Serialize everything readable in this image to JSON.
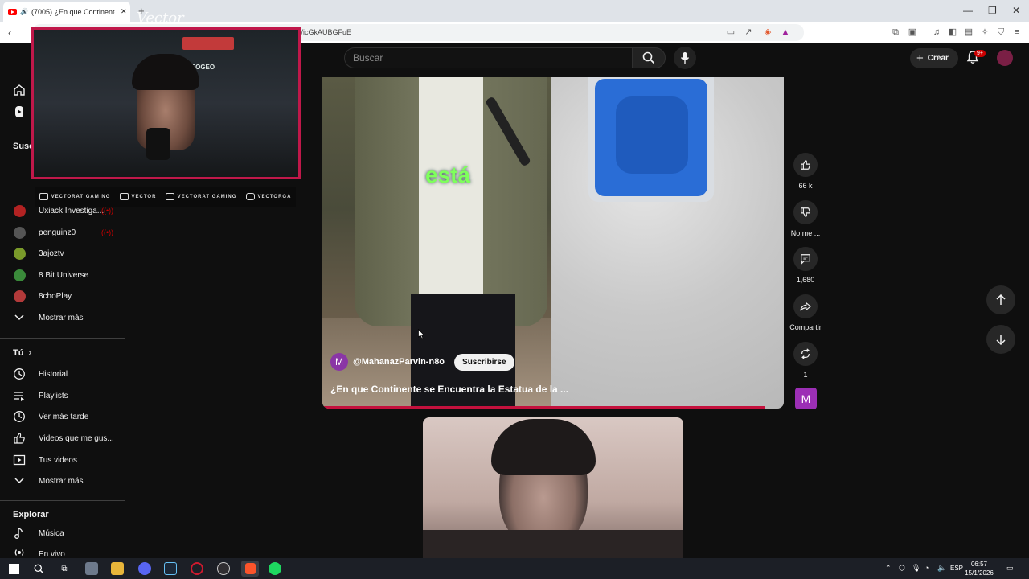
{
  "browser": {
    "tab_title": "(7005) ¿En que Continente se",
    "new_tab": "+",
    "url": "s/icGkAUBGFuE",
    "window_controls": [
      "—",
      "❐",
      "✕"
    ]
  },
  "youtube": {
    "search_placeholder": "Buscar",
    "create_label": "Crear",
    "notification_badge": "9+"
  },
  "sidebar": {
    "subscriptions_header": "Susc",
    "channels": [
      {
        "name": "Uxiack Investiga...",
        "color": "#b22222",
        "live": true
      },
      {
        "name": "penguinz0",
        "color": "#555555",
        "live": true
      },
      {
        "name": "3ajoztv",
        "color": "#7a9a2a",
        "live": false
      },
      {
        "name": "8 Bit Universe",
        "color": "#3a8a3a",
        "live": false
      },
      {
        "name": "8choPlay",
        "color": "#b23a3a",
        "live": false
      }
    ],
    "show_more_1": "Mostrar más",
    "you_header": "Tú",
    "you_items": [
      {
        "label": "Historial",
        "icon": "history-icon"
      },
      {
        "label": "Playlists",
        "icon": "playlists-icon"
      },
      {
        "label": "Ver más tarde",
        "icon": "watch-later-icon"
      },
      {
        "label": "Videos que me gus...",
        "icon": "liked-icon"
      },
      {
        "label": "Tus videos",
        "icon": "your-videos-icon"
      }
    ],
    "show_more_2": "Mostrar más",
    "explore_header": "Explorar",
    "explore_items": [
      {
        "label": "Música",
        "icon": "music-icon"
      },
      {
        "label": "En vivo",
        "icon": "live-icon"
      }
    ]
  },
  "overlay": {
    "brand": "Vector",
    "sign": "NEOGEO",
    "socials": [
      "VECTORAT GAMING",
      "VECTOR",
      "VECTORAT GAMING",
      "VECTORGA"
    ]
  },
  "short": {
    "caption": "está",
    "channel_initial": "M",
    "channel_name": "@MahanazParvin-n8o",
    "subscribe_label": "Suscribirse",
    "title": "¿En que Continente se Encuentra la Estatua de la ...",
    "progress": 0.96
  },
  "actions": {
    "likes": "66 k",
    "dislike": "No me ...",
    "comments": "1,680",
    "share": "Compartir",
    "remix": "1",
    "channel_tile": "M"
  },
  "taskbar": {
    "lang": "ESP",
    "time": "06:57",
    "date": "15/1/2026"
  }
}
